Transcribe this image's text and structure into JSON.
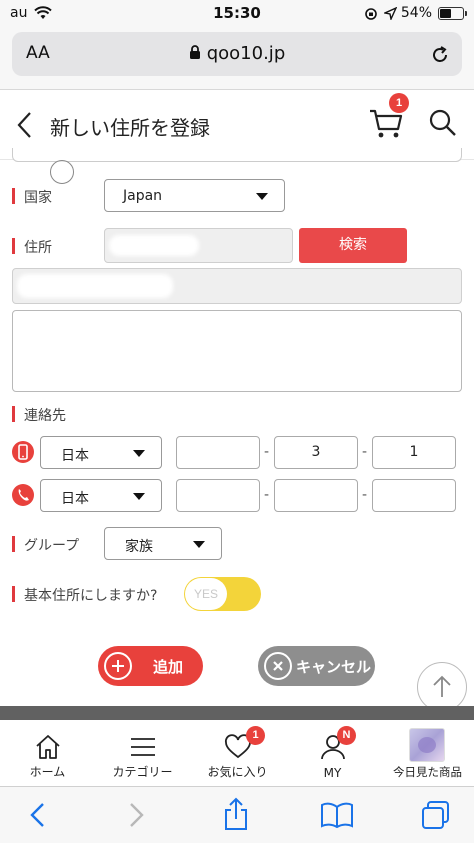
{
  "status_bar": {
    "carrier": "au",
    "time": "15:30",
    "battery_percent": "54%",
    "battery_level": 0.54
  },
  "browser": {
    "text_size_label": "AA",
    "url": "qoo10.jp"
  },
  "header": {
    "title": "新しい住所を登録",
    "cart_count": "1"
  },
  "form": {
    "country_label": "国家",
    "country_value": "Japan",
    "address_label": "住所",
    "search_button": "検索",
    "contact_label": "連絡先",
    "mobile": {
      "country": "日本",
      "part1": "",
      "part2": "3",
      "part3": "1"
    },
    "phone": {
      "country": "日本",
      "part1": "",
      "part2": "",
      "part3": ""
    },
    "group_label": "グループ",
    "group_value": "家族",
    "default_label": "基本住所にしますか?",
    "default_toggle": "YES",
    "add_button": "追加",
    "cancel_button": "キャンセル"
  },
  "tabbar": {
    "items": [
      {
        "label": "ホーム",
        "icon": "home-icon"
      },
      {
        "label": "カテゴリー",
        "icon": "menu-icon"
      },
      {
        "label": "お気に入り",
        "icon": "heart-icon",
        "badge": "1"
      },
      {
        "label": "MY",
        "icon": "person-icon",
        "badge": "N"
      },
      {
        "label": "今日見た商品",
        "icon": "product-thumbnail"
      }
    ]
  },
  "colors": {
    "accent_red": "#e8413c",
    "toggle_yellow": "#f3d43a",
    "cancel_grey": "#8e8e8e"
  }
}
